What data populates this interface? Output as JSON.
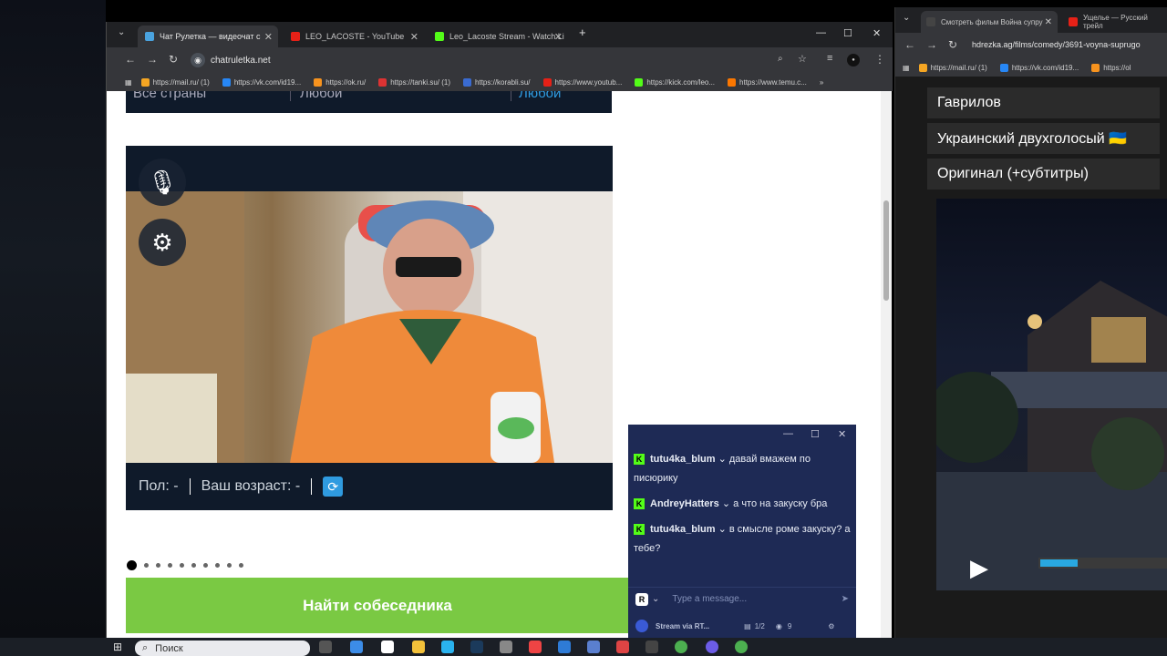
{
  "main_window": {
    "tabs": [
      {
        "label": "Чат Рулетка — видеочат с",
        "active": true
      },
      {
        "label": "LEO_LACOSTE - YouTube",
        "active": false
      },
      {
        "label": "Leo_Lacoste Stream - Watch Li",
        "active": false
      }
    ],
    "new_tab": "+",
    "url": "chatruletka.net",
    "bookmarks": [
      "https://mail.ru/ (1)",
      "https://vk.com/id19...",
      "https://ok.ru/",
      "https://tanki.su/ (1)",
      "https://korabli.su/",
      "https://www.youtub...",
      "https://kick.com/leo...",
      "https://www.temu.c..."
    ],
    "filters": {
      "country": "Все страны",
      "age": "Любой",
      "gender": "Любой"
    },
    "video_footer": {
      "gender_label": "Пол: -",
      "age_label": "Ваш возраст: -"
    },
    "find_button": "Найти собеседника"
  },
  "chat": {
    "messages": [
      {
        "user": "tutu4ka_blum",
        "text": "давай вмажем по писюрику"
      },
      {
        "user": "AndreyHatters",
        "text": "а что на закуску бра"
      },
      {
        "user": "tutu4ka_blum",
        "text": "в смысле роме закуску? а тебе?"
      }
    ],
    "input_placeholder": "Type a message...",
    "status_label": "Stream via RT...",
    "page_counter": "1/2",
    "viewers": "9"
  },
  "right_window": {
    "tabs": [
      {
        "label": "Смотреть фильм Война супру",
        "active": true
      },
      {
        "label": "Ущелье — Русский трейл",
        "active": false
      }
    ],
    "url": "hdrezka.ag/films/comedy/3691-voyna-suprugo",
    "bookmarks": [
      "https://mail.ru/ (1)",
      "https://vk.com/id19...",
      "https://ol"
    ],
    "voice_options": [
      "Гаврилов",
      "Украинский двухголосый 🇺🇦",
      "Оригинал (+субтитры)"
    ],
    "progress": 0.3
  },
  "taskbar": {
    "search_label": "Поиск"
  }
}
